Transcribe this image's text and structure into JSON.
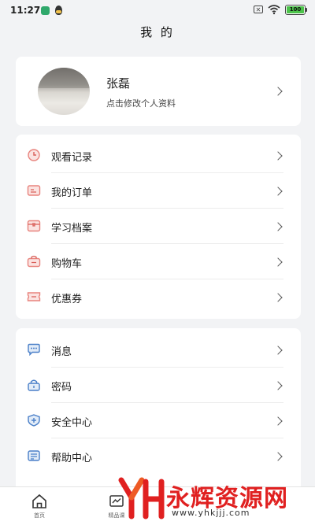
{
  "status_bar": {
    "time": "11:27",
    "battery": "100"
  },
  "page_title": "我 的",
  "profile": {
    "name": "张磊",
    "subtitle": "点击修改个人资料"
  },
  "menu_group_1": [
    {
      "label": "观看记录",
      "icon": "clock-icon"
    },
    {
      "label": "我的订单",
      "icon": "order-icon"
    },
    {
      "label": "学习档案",
      "icon": "archive-icon"
    },
    {
      "label": "购物车",
      "icon": "bag-icon"
    },
    {
      "label": "优惠券",
      "icon": "coupon-icon"
    }
  ],
  "menu_group_2": [
    {
      "label": "消息",
      "icon": "message-icon"
    },
    {
      "label": "密码",
      "icon": "lock-icon"
    },
    {
      "label": "安全中心",
      "icon": "shield-icon"
    },
    {
      "label": "帮助中心",
      "icon": "help-icon"
    }
  ],
  "tabbar": [
    {
      "label": "首页",
      "icon": "home-icon"
    },
    {
      "label": "精品课",
      "icon": "course-icon"
    }
  ],
  "watermark": {
    "text": "永辉资源网",
    "url": "www.yhkjjj.com"
  },
  "colors": {
    "accent_red": "#e8837d",
    "accent_blue": "#4a7fc8",
    "watermark_red": "#e02020"
  }
}
